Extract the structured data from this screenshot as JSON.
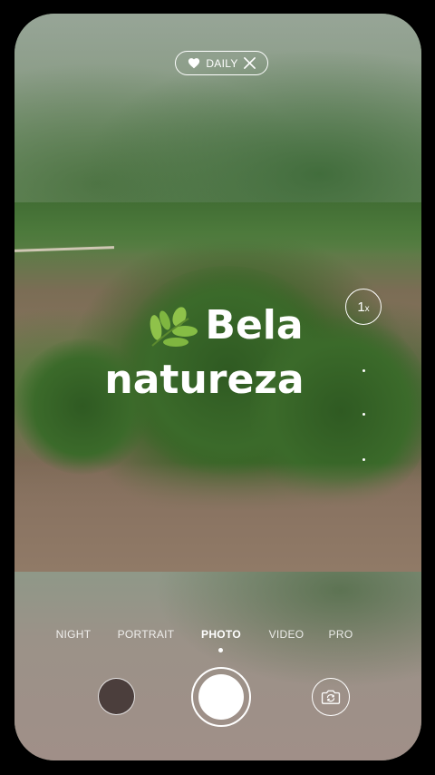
{
  "top_badge": {
    "label": "DAILY",
    "icon_left": "heart-icon",
    "icon_right": "close-icon"
  },
  "overlay": {
    "title_line1": "Bela",
    "title_line2": "natureza",
    "emoji_icon": "leaf-icon"
  },
  "zoom": {
    "value": "1",
    "suffix": "x"
  },
  "modes": {
    "items": [
      "NIGHT",
      "PORTRAIT",
      "PHOTO",
      "VIDEO",
      "PRO"
    ],
    "active": "PHOTO"
  },
  "controls": {
    "gallery_icon": "gallery-thumbnail",
    "shutter_icon": "shutter-button",
    "switch_icon": "camera-switch-icon"
  },
  "colors": {
    "background": "#000000",
    "overlay_text": "#ffffff"
  }
}
